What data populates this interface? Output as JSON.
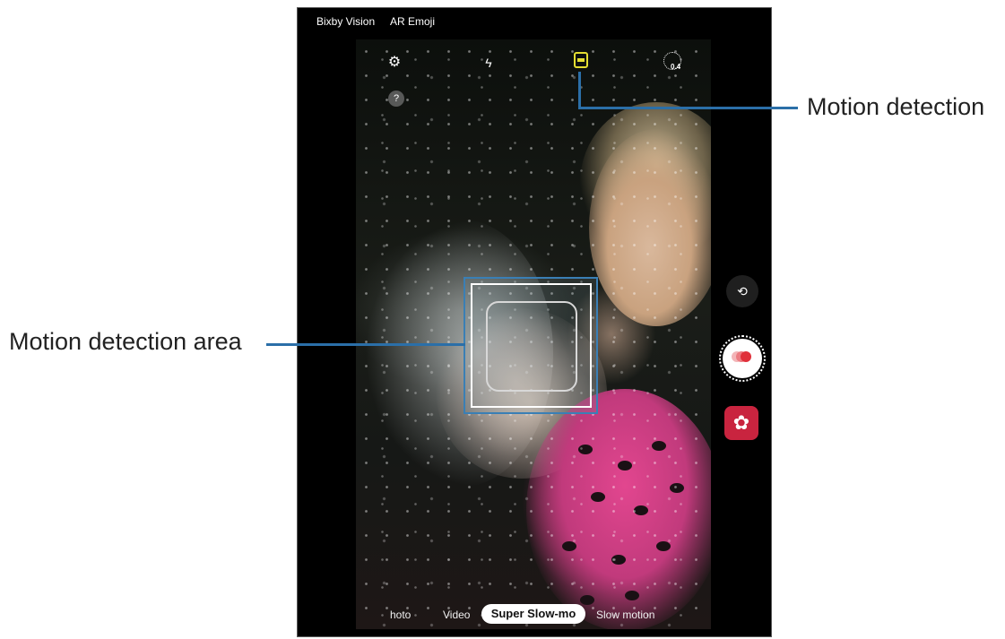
{
  "top_bar": {
    "bixby_vision": "Bixby Vision",
    "ar_emoji": "AR Emoji"
  },
  "top_icons": {
    "settings": "gear-icon",
    "flash": "flash-off-icon",
    "motion_detection": "motion-detection-icon",
    "timer_value": "0.4",
    "help": "?"
  },
  "modes": [
    "hoto",
    "Video",
    "Super Slow-mo",
    "Slow motion"
  ],
  "selected_mode": "Super Slow-mo",
  "callouts": {
    "motion_detection": "Motion detection",
    "motion_detection_area": "Motion detection area"
  },
  "colors": {
    "accent_line": "#2b6fa8",
    "motion_icon": "#e5de32",
    "record_red": "#e0303a",
    "gallery_button": "#c9243f"
  }
}
